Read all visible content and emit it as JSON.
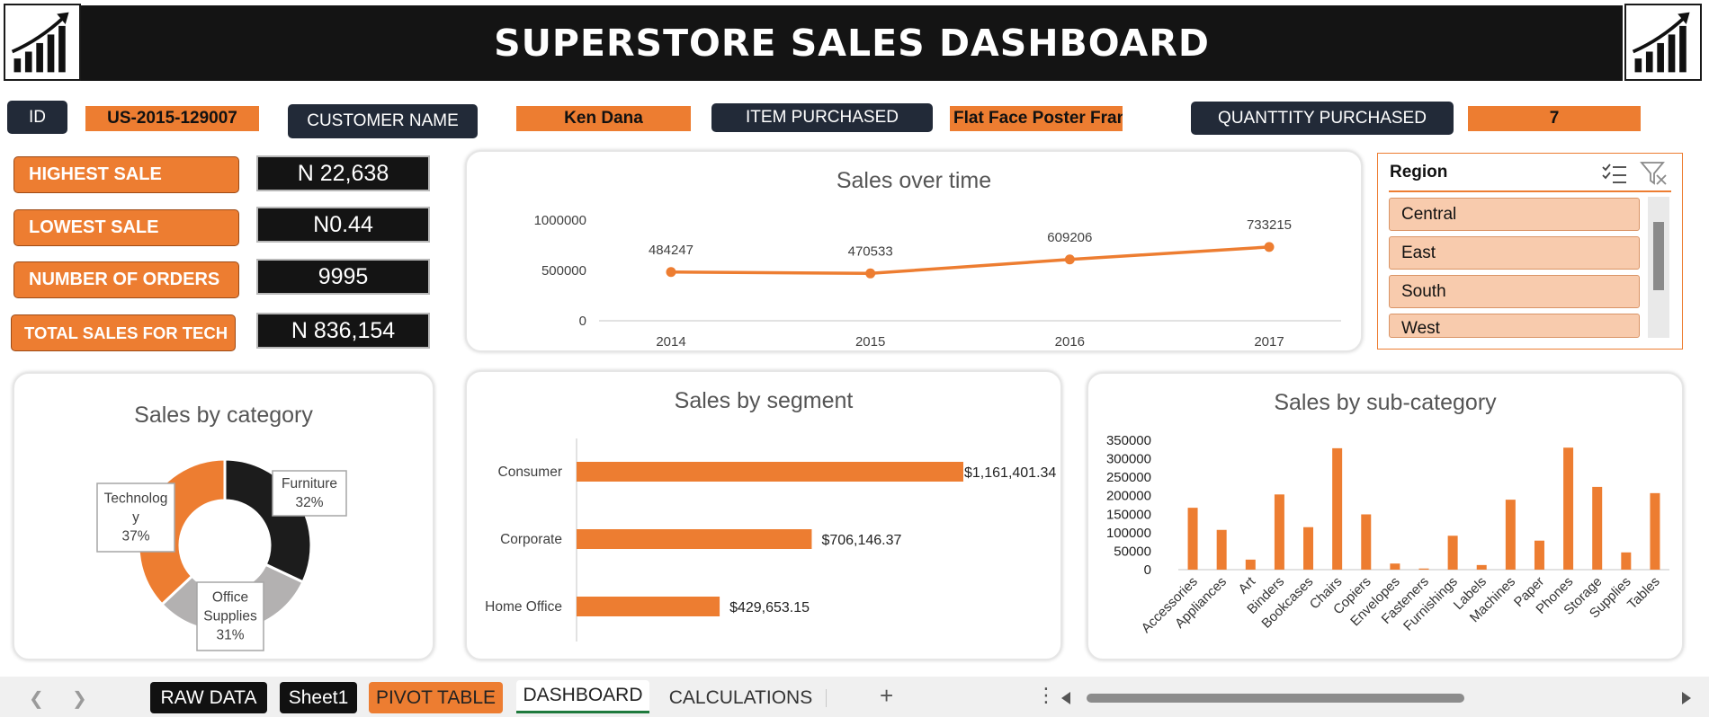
{
  "header": {
    "title": "SUPERSTORE SALES DASHBOARD"
  },
  "icons": {
    "logo_left": "growth-chart-icon",
    "logo_right": "growth-chart-icon"
  },
  "info": {
    "id_label": "ID",
    "id_value": "US-2015-129007",
    "customer_label": "CUSTOMER NAME",
    "customer_value": "Ken Dana",
    "item_label": "ITEM PURCHASED",
    "item_value": "Flat Face Poster Fran",
    "quantity_label": "QUANTTITY PURCHASED",
    "quantity_value": "7"
  },
  "kpis": [
    {
      "label": "HIGHEST SALE",
      "value": "N 22,638"
    },
    {
      "label": "LOWEST SALE",
      "value": "N0.44"
    },
    {
      "label": "NUMBER OF ORDERS",
      "value": "9995"
    },
    {
      "label": "TOTAL SALES FOR TECH",
      "value": "N 836,154"
    }
  ],
  "slicer": {
    "title": "Region",
    "items": [
      "Central",
      "East",
      "South",
      "West"
    ],
    "multiselect_icon": "multi-select-icon",
    "clear_filter_icon": "clear-filter-icon"
  },
  "chart_data": [
    {
      "id": "sales_over_time",
      "type": "line",
      "title": "Sales over time",
      "categories": [
        "2014",
        "2015",
        "2016",
        "2017"
      ],
      "values": [
        484247,
        470533,
        609206,
        733215
      ],
      "data_labels": [
        "484247",
        "470533",
        "609206",
        "733215"
      ],
      "y_ticks": [
        "0",
        "500000",
        "1000000"
      ],
      "ylim": [
        0,
        1000000
      ],
      "color": "#ed7d31",
      "grid": false
    },
    {
      "id": "sales_by_category",
      "type": "pie",
      "title": "Sales by category",
      "slices": [
        {
          "name": "Furniture",
          "percent": 32,
          "color": "#1c1c1c",
          "label_lines": [
            "Furniture",
            "32%"
          ]
        },
        {
          "name": "Office Supplies",
          "percent": 31,
          "color": "#b3b1b1",
          "label_lines": [
            "Office",
            "Supplies",
            "31%"
          ]
        },
        {
          "name": "Technology",
          "percent": 37,
          "color": "#ed7d31",
          "label_lines": [
            "Technolog",
            "y",
            "37%"
          ]
        }
      ]
    },
    {
      "id": "sales_by_segment",
      "type": "bar",
      "orientation": "horizontal",
      "title": "Sales by segment",
      "categories": [
        "Consumer",
        "Corporate",
        "Home Office"
      ],
      "values": [
        1161401.34,
        706146.37,
        429653.15
      ],
      "data_labels": [
        "$1,161,401.34",
        "$706,146.37",
        "$429,653.15"
      ],
      "color": "#ed7d31"
    },
    {
      "id": "sales_by_sub_category",
      "type": "bar",
      "title": "Sales by sub-category",
      "categories": [
        "Accessories",
        "Appliances",
        "Art",
        "Binders",
        "Bookcases",
        "Chairs",
        "Copiers",
        "Envelopes",
        "Fasteners",
        "Furnishings",
        "Labels",
        "Machines",
        "Paper",
        "Phones",
        "Storage",
        "Supplies",
        "Tables"
      ],
      "values": [
        167380,
        107532,
        27119,
        203413,
        114880,
        328449,
        149528,
        16476,
        3024,
        91705,
        12486,
        189239,
        78479,
        330007,
        223844,
        46674,
        206966
      ],
      "y_ticks": [
        "0",
        "50000",
        "100000",
        "150000",
        "200000",
        "250000",
        "300000",
        "350000"
      ],
      "ylim": [
        0,
        350000
      ],
      "color": "#ed7d31"
    }
  ],
  "tabs": {
    "items": [
      {
        "label": "RAW DATA",
        "style": "dark"
      },
      {
        "label": "Sheet1",
        "style": "dark"
      },
      {
        "label": "PIVOT TABLE",
        "style": "orange"
      },
      {
        "label": "DASHBOARD",
        "style": "active"
      },
      {
        "label": "CALCULATIONS",
        "style": "plain"
      }
    ],
    "add_icon": "plus-icon",
    "more_icon": "more-vertical-icon",
    "prev_icon": "chevron-left-icon",
    "next_icon": "chevron-right-icon"
  }
}
